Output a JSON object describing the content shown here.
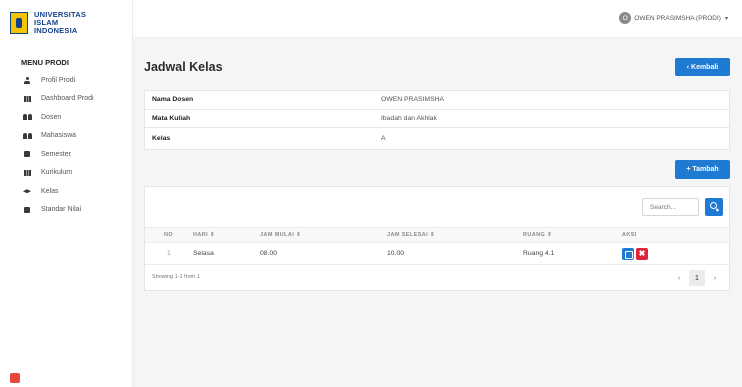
{
  "brand": {
    "line1": "UNIVERSITAS",
    "line2": "ISLAM",
    "line3": "INDONESIA"
  },
  "sidebar": {
    "title": "MENU PRODI",
    "items": [
      {
        "label": "Profil Prodi",
        "icon": "person-icon"
      },
      {
        "label": "Dashboard Prodi",
        "icon": "grid-icon"
      },
      {
        "label": "Dosen",
        "icon": "people-icon"
      },
      {
        "label": "Mahasiswa",
        "icon": "people-icon"
      },
      {
        "label": "Semester",
        "icon": "box-icon"
      },
      {
        "label": "Kurikulum",
        "icon": "table-icon"
      },
      {
        "label": "Kelas",
        "icon": "cap-icon"
      },
      {
        "label": "Standar Nilai",
        "icon": "box-icon"
      }
    ]
  },
  "topbar": {
    "avatar_initial": "O",
    "user_name": "OWEN PRASIMSHA (PRODI)",
    "caret": "▾"
  },
  "page": {
    "title": "Jadwal Kelas",
    "back_label": "‹ Kembali",
    "add_label": "+ Tambah"
  },
  "info": {
    "rows": [
      {
        "key": "Nama Dosen",
        "value": "OWEN PRASIMSHA"
      },
      {
        "key": "Mata Kuliah",
        "value": "Ibadah dan Akhlak"
      },
      {
        "key": "Kelas",
        "value": "A"
      }
    ]
  },
  "table": {
    "search_placeholder": "Search...",
    "headers": [
      "NO",
      "HARI ⇕",
      "JAM MULAI ⇕",
      "JAM SELESAI ⇕",
      "RUANG ⇕",
      "AKSI"
    ],
    "rows": [
      {
        "no": "1",
        "hari": "Selasa",
        "jam_mulai": "08.00",
        "jam_selesai": "10.00",
        "ruang": "Ruang 4.1"
      }
    ],
    "delete_glyph": "✖",
    "showing": "Showing 1-1 from 1",
    "pager": {
      "prev": "‹",
      "current": "1",
      "next": "›"
    }
  },
  "colors": {
    "primary": "#1f7ad4",
    "danger": "#e0233a",
    "brand_blue": "#123f8a",
    "brand_yellow": "#f5c400"
  }
}
